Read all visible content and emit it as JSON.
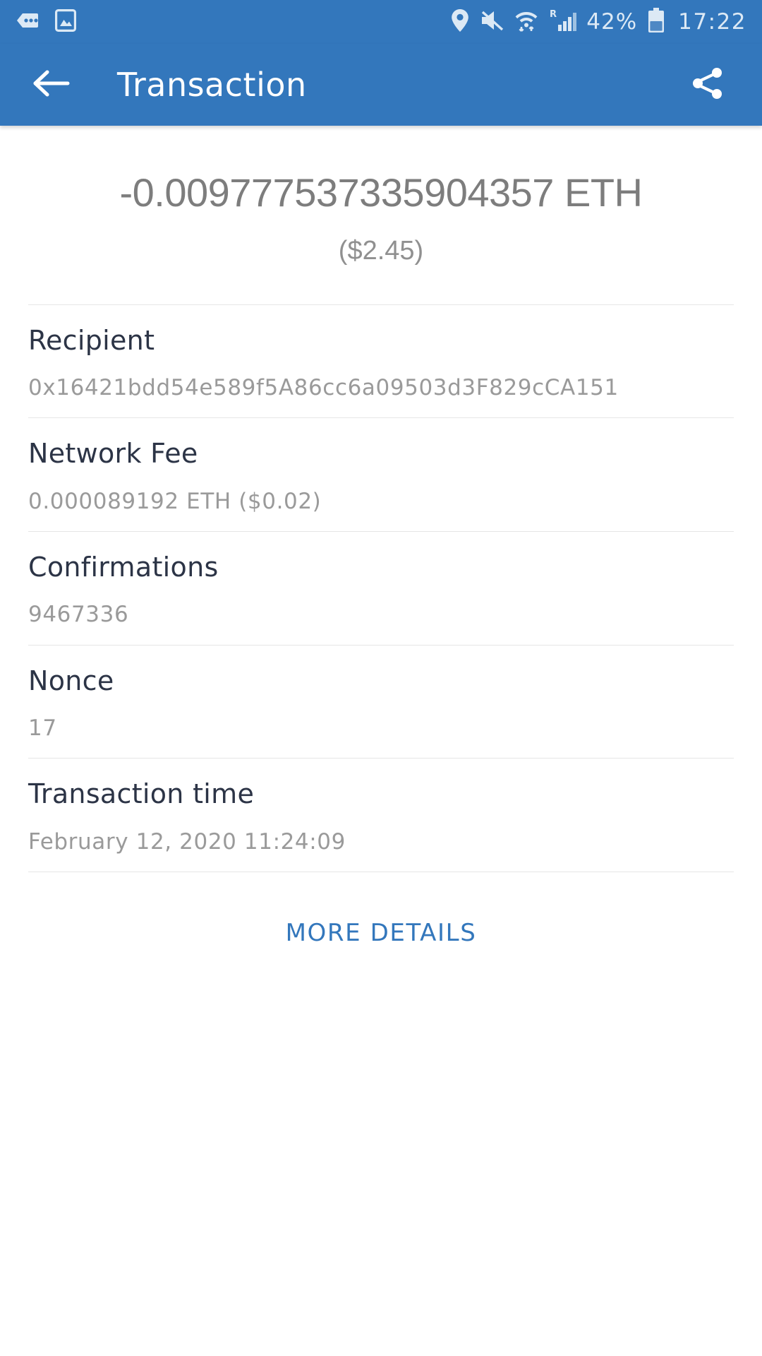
{
  "theme": {
    "primary": "#3377BC",
    "app_bar_text": "#ffffff",
    "label_color": "#2C3446",
    "value_color": "#9A9A9A",
    "amount_color": "#7D7D7D",
    "link_color": "#3377BC",
    "divider_color": "#E6E6E6",
    "page_background": "#ffffff"
  },
  "status_bar": {
    "left_icons": [
      {
        "name": "chat-bubble-dots-icon"
      },
      {
        "name": "screenshot-image-icon"
      }
    ],
    "right_icons": [
      {
        "name": "location-pin-icon"
      },
      {
        "name": "volume-mute-icon"
      },
      {
        "name": "wifi-data-transfer-icon"
      },
      {
        "name": "roaming-signal-icon",
        "badge": "R"
      },
      {
        "name": "battery-icon"
      }
    ],
    "battery_percent": "42%",
    "clock": "17:22"
  },
  "app_bar": {
    "back_icon": "arrow-left-icon",
    "title": "Transaction",
    "share_icon": "share-icon"
  },
  "transaction": {
    "amount": "-0.009777537335904357 ETH",
    "fiat_amount": "($2.45)",
    "details": [
      {
        "label": "Recipient",
        "value": "0x16421bdd54e589f5A86cc6a09503d3F829cCA151"
      },
      {
        "label": "Network Fee",
        "value": "0.000089192 ETH ($0.02)"
      },
      {
        "label": "Confirmations",
        "value": "9467336"
      },
      {
        "label": "Nonce",
        "value": "17"
      },
      {
        "label": "Transaction time",
        "value": "February 12, 2020 11:24:09"
      }
    ],
    "more_details_label": "MORE DETAILS"
  }
}
